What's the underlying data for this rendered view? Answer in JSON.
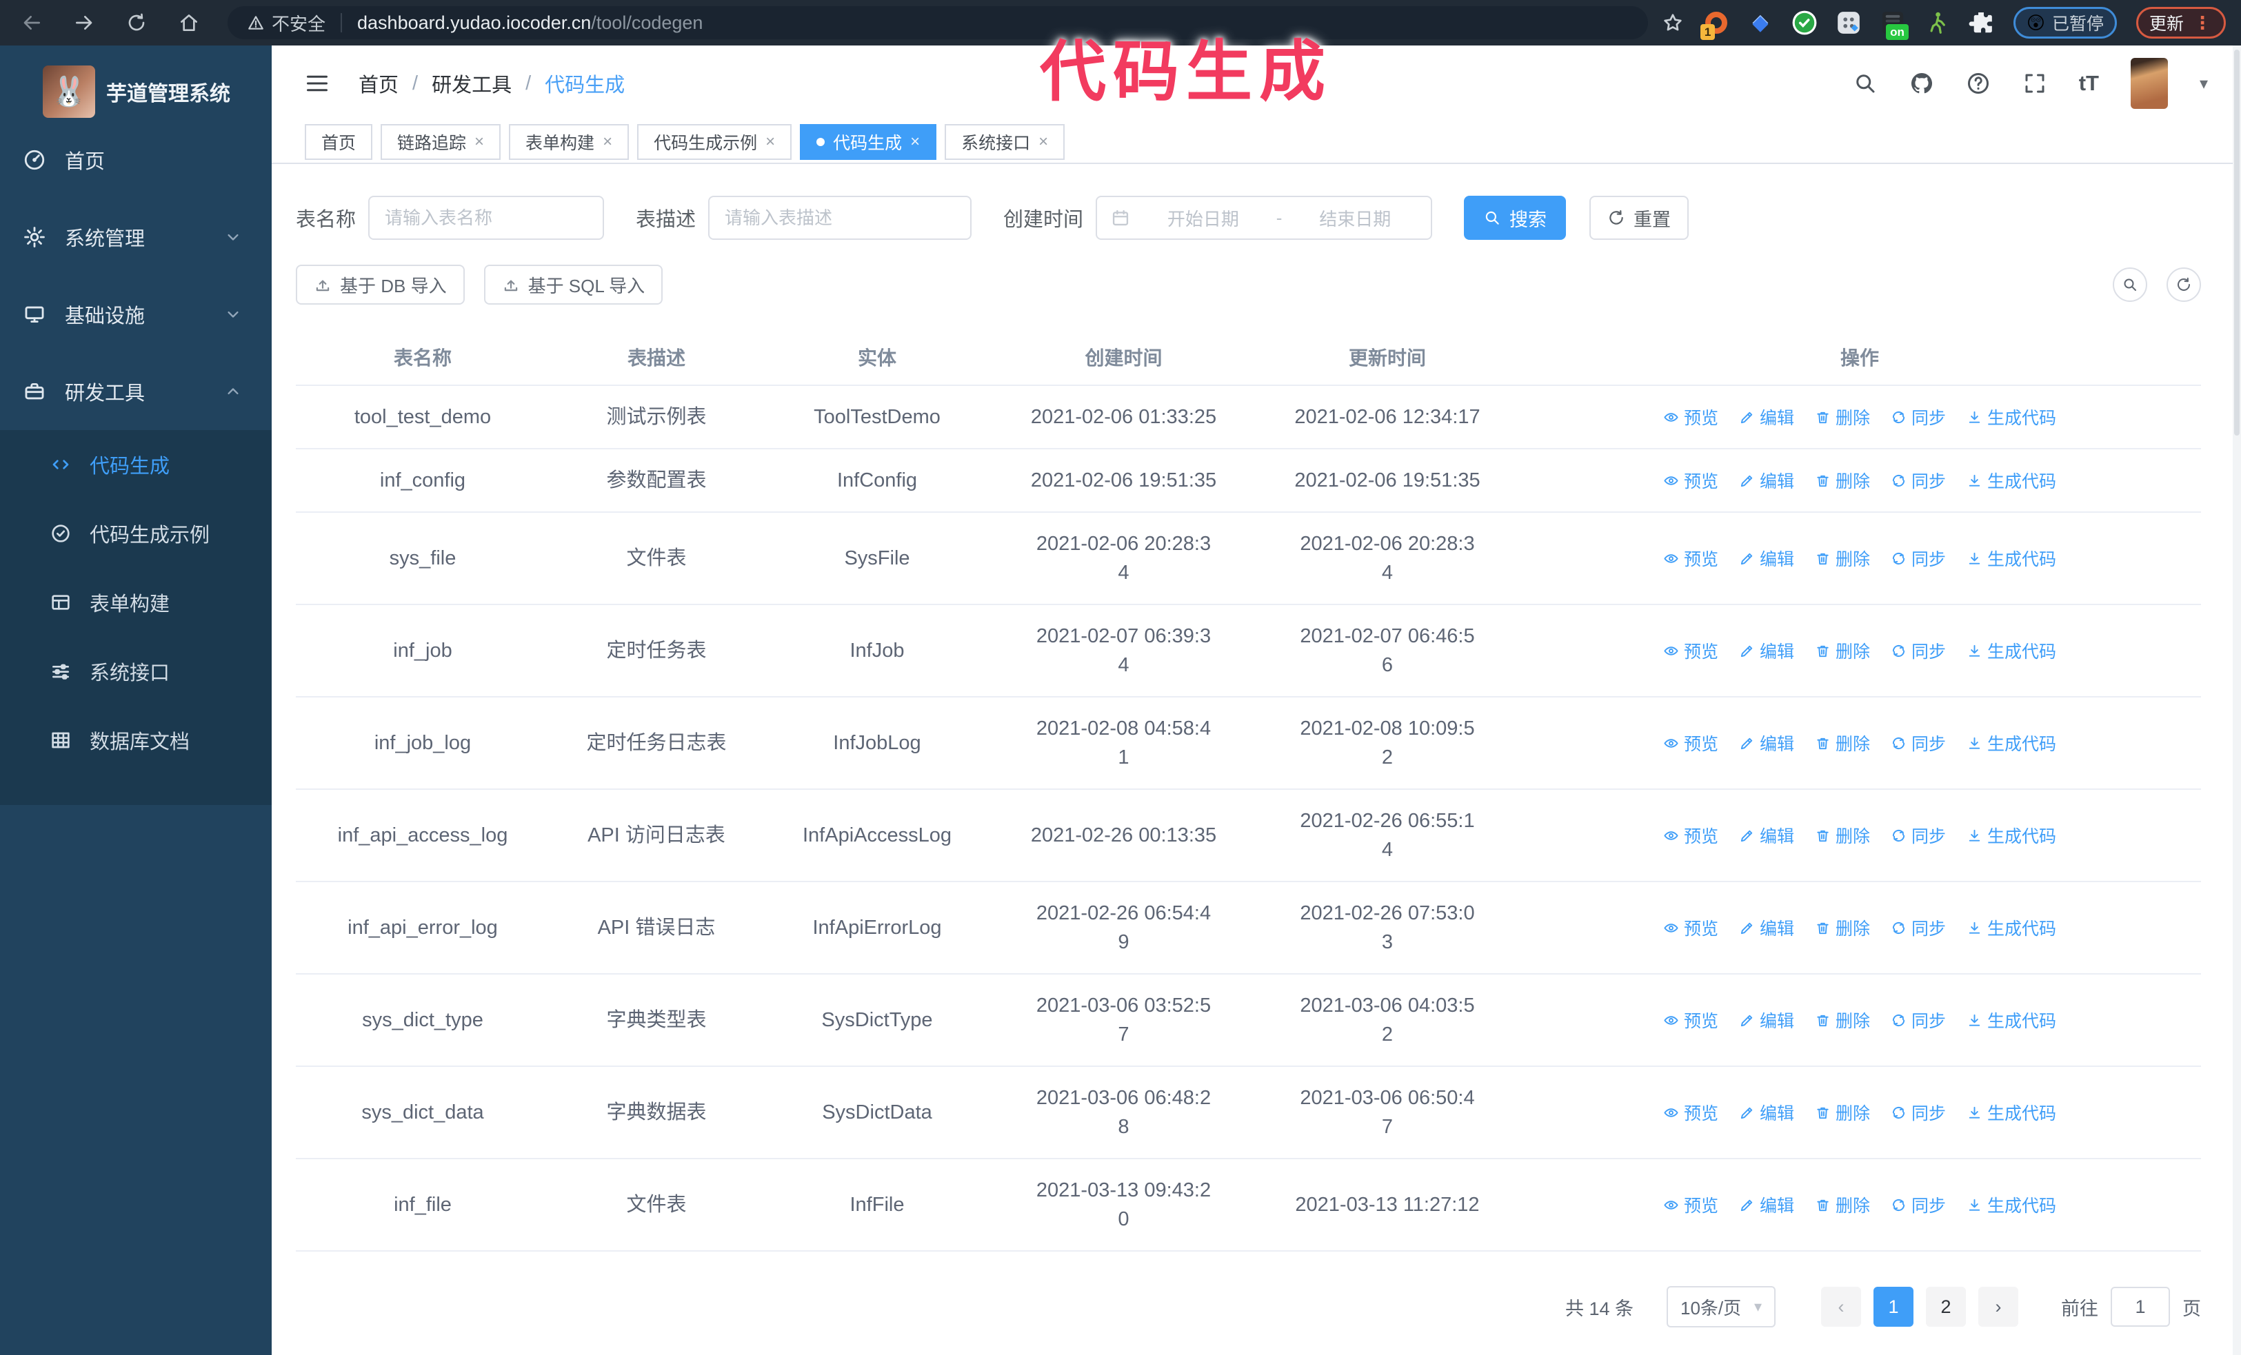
{
  "browser": {
    "security_label": "不安全",
    "url_host": "dashboard.yudao.iocoder.cn",
    "url_path": "/tool/codegen",
    "extensions": [
      {
        "icon": "ext-orange-circle-icon",
        "style": "ext-orange",
        "badge": "1"
      },
      {
        "icon": "ext-blue-gem-icon",
        "style": "ext-gem"
      },
      {
        "icon": "ext-green-check-icon",
        "style": "ext-check",
        "svg": "ext-check"
      },
      {
        "icon": "ext-grid-icon",
        "style": "ext-grid",
        "svg": "ext-grid"
      },
      {
        "icon": "ext-dark-on-icon",
        "style": "ext-dark",
        "svg": "ext-dark",
        "badge": "on"
      },
      {
        "icon": "ext-green-figure-icon",
        "style": "ext-figure",
        "svg": "ext-figure"
      },
      {
        "icon": "ext-puzzle-icon",
        "style": "ext-puzzle",
        "svg": "ext-puzzle"
      }
    ],
    "paused_badge": "已暂停",
    "update_button": "更新"
  },
  "annotation": {
    "text": "代码生成"
  },
  "sidebar": {
    "title": "芋道管理系统",
    "items": [
      {
        "key": "home",
        "label": "首页",
        "icon": "dashboard-icon"
      },
      {
        "key": "system",
        "label": "系统管理",
        "icon": "gear-icon",
        "chevron": "down"
      },
      {
        "key": "infra",
        "label": "基础设施",
        "icon": "monitor-icon",
        "chevron": "down"
      },
      {
        "key": "devtools",
        "label": "研发工具",
        "icon": "toolbox-icon",
        "chevron": "up"
      }
    ],
    "subitems": [
      {
        "key": "codegen",
        "label": "代码生成",
        "icon": "code-icon",
        "active": true
      },
      {
        "key": "codegen-example",
        "label": "代码生成示例",
        "icon": "badge-check-icon"
      },
      {
        "key": "form-builder",
        "label": "表单构建",
        "icon": "form-icon"
      },
      {
        "key": "system-api",
        "label": "系统接口",
        "icon": "sliders-icon"
      },
      {
        "key": "db-doc",
        "label": "数据库文档",
        "icon": "table-grid-icon"
      }
    ]
  },
  "header": {
    "breadcrumb": [
      "首页",
      "研发工具",
      "代码生成"
    ],
    "breadcrumb_separator": "/"
  },
  "tabs": [
    {
      "label": "首页",
      "closable": false,
      "active": false
    },
    {
      "label": "链路追踪",
      "closable": true,
      "active": false
    },
    {
      "label": "表单构建",
      "closable": true,
      "active": false
    },
    {
      "label": "代码生成示例",
      "closable": true,
      "active": false
    },
    {
      "label": "代码生成",
      "closable": true,
      "active": true
    },
    {
      "label": "系统接口",
      "closable": true,
      "active": false
    }
  ],
  "filters": {
    "name_label": "表名称",
    "name_placeholder": "请输入表名称",
    "desc_label": "表描述",
    "desc_placeholder": "请输入表描述",
    "time_label": "创建时间",
    "start_placeholder": "开始日期",
    "end_placeholder": "结束日期",
    "range_separator": "-",
    "search_label": "搜索",
    "reset_label": "重置"
  },
  "toolbar": {
    "import_db_label": "基于 DB 导入",
    "import_sql_label": "基于 SQL 导入"
  },
  "table": {
    "columns": [
      "表名称",
      "表描述",
      "实体",
      "创建时间",
      "更新时间",
      "操作"
    ],
    "actions": [
      "预览",
      "编辑",
      "删除",
      "同步",
      "生成代码"
    ],
    "rows": [
      {
        "name": "tool_test_demo",
        "desc": "测试示例表",
        "entity": "ToolTestDemo",
        "created": "2021-02-06 01:33:25",
        "updated": "2021-02-06 12:34:17"
      },
      {
        "name": "inf_config",
        "desc": "参数配置表",
        "entity": "InfConfig",
        "created": "2021-02-06 19:51:35",
        "updated": "2021-02-06 19:51:35"
      },
      {
        "name": "sys_file",
        "desc": "文件表",
        "entity": "SysFile",
        "created": "2021-02-06 20:28:3\n4",
        "updated": "2021-02-06 20:28:3\n4"
      },
      {
        "name": "inf_job",
        "desc": "定时任务表",
        "entity": "InfJob",
        "created": "2021-02-07 06:39:3\n4",
        "updated": "2021-02-07 06:46:5\n6"
      },
      {
        "name": "inf_job_log",
        "desc": "定时任务日志表",
        "entity": "InfJobLog",
        "created": "2021-02-08 04:58:4\n1",
        "updated": "2021-02-08 10:09:5\n2"
      },
      {
        "name": "inf_api_access_log",
        "desc": "API 访问日志表",
        "entity": "InfApiAccessLog",
        "created": "2021-02-26 00:13:35",
        "updated": "2021-02-26 06:55:1\n4"
      },
      {
        "name": "inf_api_error_log",
        "desc": "API 错误日志",
        "entity": "InfApiErrorLog",
        "created": "2021-02-26 06:54:4\n9",
        "updated": "2021-02-26 07:53:0\n3"
      },
      {
        "name": "sys_dict_type",
        "desc": "字典类型表",
        "entity": "SysDictType",
        "created": "2021-03-06 03:52:5\n7",
        "updated": "2021-03-06 04:03:5\n2"
      },
      {
        "name": "sys_dict_data",
        "desc": "字典数据表",
        "entity": "SysDictData",
        "created": "2021-03-06 06:48:2\n8",
        "updated": "2021-03-06 06:50:4\n7"
      },
      {
        "name": "inf_file",
        "desc": "文件表",
        "entity": "InfFile",
        "created": "2021-03-13 09:43:2\n0",
        "updated": "2021-03-13 11:27:12"
      }
    ]
  },
  "pagination": {
    "total": "共 14 条",
    "page_size": "10条/页",
    "pages": [
      "1",
      "2"
    ],
    "active_page": "1",
    "goto_label": "前往",
    "goto_value": "1",
    "page_suffix": "页"
  },
  "colors": {
    "accent": "#409eff",
    "sidebar_bg": "#21435e",
    "submenu_bg": "#1b394f",
    "annotation": "#f23b5f"
  }
}
